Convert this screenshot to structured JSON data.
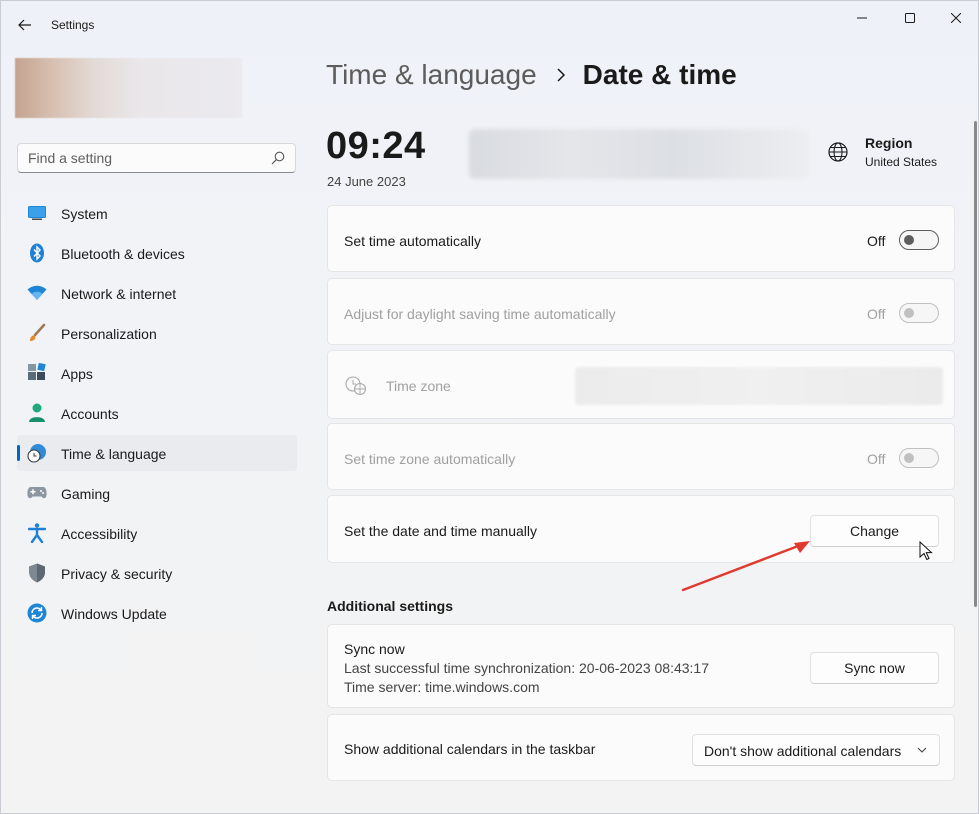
{
  "window": {
    "title": "Settings"
  },
  "search": {
    "placeholder": "Find a setting"
  },
  "sidebar": {
    "items": [
      {
        "label": "System",
        "icon": "monitor-icon",
        "active": false
      },
      {
        "label": "Bluetooth & devices",
        "icon": "bluetooth-icon",
        "active": false
      },
      {
        "label": "Network & internet",
        "icon": "wifi-icon",
        "active": false
      },
      {
        "label": "Personalization",
        "icon": "paintbrush-icon",
        "active": false
      },
      {
        "label": "Apps",
        "icon": "apps-icon",
        "active": false
      },
      {
        "label": "Accounts",
        "icon": "person-icon",
        "active": false
      },
      {
        "label": "Time & language",
        "icon": "clock-globe-icon",
        "active": true
      },
      {
        "label": "Gaming",
        "icon": "gamepad-icon",
        "active": false
      },
      {
        "label": "Accessibility",
        "icon": "accessibility-icon",
        "active": false
      },
      {
        "label": "Privacy & security",
        "icon": "shield-icon",
        "active": false
      },
      {
        "label": "Windows Update",
        "icon": "update-icon",
        "active": false
      }
    ]
  },
  "breadcrumb": {
    "parent": "Time & language",
    "current": "Date & time"
  },
  "clock": {
    "time": "09:24",
    "date": "24 June 2023"
  },
  "region": {
    "title": "Region",
    "value": "United States"
  },
  "settings": {
    "set_time_auto": {
      "label": "Set time automatically",
      "state": "Off"
    },
    "daylight": {
      "label": "Adjust for daylight saving time automatically",
      "state": "Off"
    },
    "timezone": {
      "label": "Time zone"
    },
    "timezone_auto": {
      "label": "Set time zone automatically",
      "state": "Off"
    },
    "manual": {
      "label": "Set the date and time manually",
      "button": "Change"
    }
  },
  "additional": {
    "title": "Additional settings",
    "sync": {
      "title": "Sync now",
      "last_sync": "Last successful time synchronization: 20-06-2023 08:43:17",
      "server": "Time server: time.windows.com",
      "button": "Sync now"
    },
    "calendars": {
      "label": "Show additional calendars in the taskbar",
      "selected": "Don't show additional calendars"
    }
  },
  "colors": {
    "accent": "#0067c0",
    "annotation_arrow": "#e03a2f"
  }
}
